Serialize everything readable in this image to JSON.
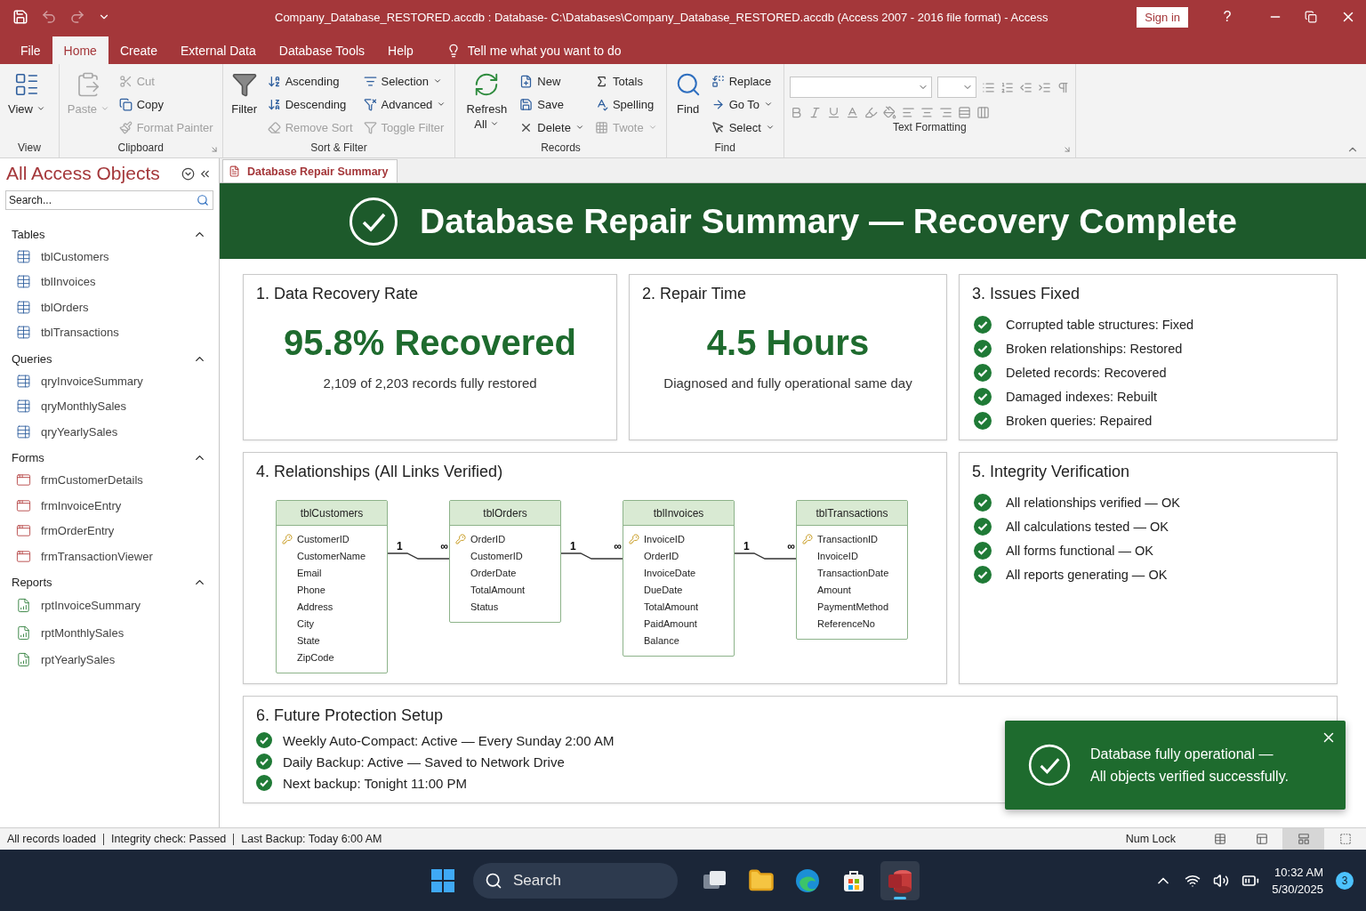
{
  "window": {
    "title": "Company_Database_RESTORED.accdb : Database- C:\\Databases\\Company_Database_RESTORED.accdb (Access 2007 - 2016 file format) - Access",
    "sign_in": "Sign in",
    "help": "?"
  },
  "menu_tabs": [
    {
      "label": "File",
      "selected": false
    },
    {
      "label": "Home",
      "selected": true
    },
    {
      "label": "Create",
      "selected": false
    },
    {
      "label": "External Data",
      "selected": false
    },
    {
      "label": "Database Tools",
      "selected": false
    },
    {
      "label": "Help",
      "selected": false
    }
  ],
  "tell_me": "Tell me what you want to do",
  "ribbon": {
    "groups": [
      {
        "label": "View",
        "kind": "buttons",
        "launcher": false,
        "large": {
          "kind": "view",
          "label": "View",
          "dropdown": true,
          "disabled": false
        }
      },
      {
        "label": "Clipboard",
        "kind": "buttons",
        "launcher": true,
        "large": {
          "kind": "paste",
          "label": "Paste",
          "dropdown": true,
          "disabled": true
        },
        "columns": [
          [
            {
              "kind": "cut",
              "label": "Cut",
              "dropdown": false,
              "disabled": true
            },
            {
              "kind": "copy",
              "label": "Copy",
              "dropdown": false,
              "disabled": false
            },
            {
              "kind": "painter",
              "label": "Format Painter",
              "dropdown": false,
              "disabled": true
            }
          ]
        ]
      },
      {
        "label": "Sort & Filter",
        "kind": "buttons",
        "launcher": false,
        "large": {
          "kind": "filter",
          "label": "Filter",
          "dropdown": false,
          "disabled": false
        },
        "columns": [
          [
            {
              "kind": "ascending",
              "label": "Ascending",
              "dropdown": false,
              "disabled": false
            },
            {
              "kind": "descending",
              "label": "Descending",
              "dropdown": false,
              "disabled": false
            },
            {
              "kind": "removesort",
              "label": "Remove Sort",
              "dropdown": false,
              "disabled": true
            }
          ],
          [
            {
              "kind": "selection",
              "label": "Selection",
              "dropdown": true,
              "disabled": false
            },
            {
              "kind": "advanced",
              "label": "Advanced",
              "dropdown": true,
              "disabled": false
            },
            {
              "kind": "toggle",
              "label": "Toggle Filter",
              "dropdown": false,
              "disabled": true
            }
          ]
        ]
      },
      {
        "label": "Records",
        "kind": "buttons",
        "launcher": false,
        "large": {
          "kind": "refresh",
          "label": "Refresh All",
          "dropdown": true,
          "disabled": false
        },
        "columns": [
          [
            {
              "kind": "new",
              "label": "New",
              "dropdown": false,
              "disabled": false
            },
            {
              "kind": "save",
              "label": "Save",
              "dropdown": false,
              "disabled": false
            },
            {
              "kind": "delete",
              "label": "Delete",
              "dropdown": true,
              "disabled": false
            }
          ],
          [
            {
              "kind": "totals",
              "label": "Totals",
              "dropdown": false,
              "disabled": false
            },
            {
              "kind": "spelling",
              "label": "Spelling",
              "dropdown": false,
              "disabled": false
            },
            {
              "kind": "more",
              "label": "Twote",
              "dropdown": true,
              "disabled": true
            }
          ]
        ]
      },
      {
        "label": "Find",
        "kind": "buttons",
        "launcher": false,
        "large": {
          "kind": "find",
          "label": "Find",
          "dropdown": false,
          "disabled": false
        },
        "columns": [
          [
            {
              "kind": "replace",
              "label": "Replace",
              "dropdown": false,
              "disabled": false
            },
            {
              "kind": "goto",
              "label": "Go To",
              "dropdown": true,
              "disabled": false
            },
            {
              "kind": "select",
              "label": "Select",
              "dropdown": true,
              "disabled": false
            }
          ]
        ]
      },
      {
        "label": "Text Formatting",
        "kind": "formatting",
        "launcher": true
      }
    ]
  },
  "nav": {
    "title": "All Access Objects",
    "search_placeholder": "Search...",
    "sections": [
      {
        "label": "Tables",
        "kind": "table",
        "expanded": true,
        "items": [
          "tblCustomers",
          "tblInvoices",
          "tblOrders",
          "tblTransactions"
        ]
      },
      {
        "label": "Queries",
        "kind": "query",
        "expanded": true,
        "items": [
          "qryInvoiceSummary",
          "qryMonthlySales",
          "qryYearlySales"
        ]
      },
      {
        "label": "Forms",
        "kind": "form",
        "expanded": true,
        "items": [
          "frmCustomerDetails",
          "frmInvoiceEntry",
          "frmOrderEntry",
          "frmTransactionViewer"
        ]
      },
      {
        "label": "Reports",
        "kind": "report",
        "expanded": true,
        "items": [
          "rptInvoiceSummary",
          "rptMonthlySales",
          "rptYearlySales"
        ]
      }
    ]
  },
  "document_tabs": [
    {
      "label": "Database Repair Summary",
      "selected": true
    }
  ],
  "banner": {
    "title": "Database Repair Summary — Recovery Complete"
  },
  "cards": [
    {
      "kind": "metric",
      "title": "1. Data Recovery Rate",
      "value": "95.8% Recovered",
      "caption": "2,109 of 2,203 records fully restored"
    },
    {
      "kind": "metric",
      "title": "2. Repair Time",
      "value": "4.5 Hours",
      "caption": "Diagnosed and fully operational same day"
    },
    {
      "kind": "checklist",
      "title": "3. Issues Fixed",
      "items": [
        "Corrupted table structures: Fixed",
        "Broken relationships: Restored",
        "Deleted records: Recovered",
        "Damaged indexes: Rebuilt",
        "Broken queries: Repaired"
      ]
    },
    {
      "kind": "diagram",
      "title": "4. Relationships (All Links Verified)",
      "tables": [
        {
          "name": "tblCustomers",
          "fields": [
            {
              "name": "CustomerID",
              "key": true
            },
            {
              "name": "CustomerName",
              "key": false
            },
            {
              "name": "Email",
              "key": false
            },
            {
              "name": "Phone",
              "key": false
            },
            {
              "name": "Address",
              "key": false
            },
            {
              "name": "City",
              "key": false
            },
            {
              "name": "State",
              "key": false
            },
            {
              "name": "ZipCode",
              "key": false
            }
          ]
        },
        {
          "name": "tblOrders",
          "fields": [
            {
              "name": "OrderID",
              "key": true
            },
            {
              "name": "CustomerID",
              "key": false
            },
            {
              "name": "OrderDate",
              "key": false
            },
            {
              "name": "TotalAmount",
              "key": false
            },
            {
              "name": "Status",
              "key": false
            }
          ]
        },
        {
          "name": "tblInvoices",
          "fields": [
            {
              "name": "InvoiceID",
              "key": true
            },
            {
              "name": "OrderID",
              "key": false
            },
            {
              "name": "InvoiceDate",
              "key": false
            },
            {
              "name": "DueDate",
              "key": false
            },
            {
              "name": "TotalAmount",
              "key": false
            },
            {
              "name": "PaidAmount",
              "key": false
            },
            {
              "name": "Balance",
              "key": false
            }
          ]
        },
        {
          "name": "tblTransactions",
          "fields": [
            {
              "name": "TransactionID",
              "key": true
            },
            {
              "name": "InvoiceID",
              "key": false
            },
            {
              "name": "TransactionDate",
              "key": false
            },
            {
              "name": "Amount",
              "key": false
            },
            {
              "name": "PaymentMethod",
              "key": false
            },
            {
              "name": "ReferenceNo",
              "key": false
            }
          ]
        }
      ],
      "relationships": [
        {
          "one": "1",
          "many": "∞"
        },
        {
          "one": "1",
          "many": "∞"
        },
        {
          "one": "1",
          "many": "∞"
        }
      ]
    },
    {
      "kind": "checklist",
      "title": "5. Integrity Verification",
      "items": [
        "All relationships verified — OK",
        "All calculations tested — OK",
        "All forms functional — OK",
        "All reports generating — OK"
      ]
    },
    {
      "kind": "setup",
      "title": "6. Future Protection Setup",
      "items": [
        "Weekly Auto-Compact: Active — Every Sunday 2:00 AM",
        "Daily Backup: Active — Saved to Network Drive",
        "Next backup: Tonight 11:00 PM"
      ]
    }
  ],
  "toast": {
    "lines": [
      "Database fully operational —",
      "All objects verified successfully."
    ]
  },
  "status_bar": {
    "items": [
      "All records loaded",
      "Integrity check: Passed",
      "Last Backup: Today 6:00 AM"
    ],
    "num_lock": "Num Lock",
    "views": [
      {
        "selected": false
      },
      {
        "selected": false
      },
      {
        "selected": true
      },
      {
        "selected": false
      }
    ]
  },
  "taskbar": {
    "search_placeholder": "Search",
    "apps": [
      {
        "kind": "taskview",
        "active": false
      },
      {
        "kind": "explorer",
        "active": false
      },
      {
        "kind": "edge",
        "active": false
      },
      {
        "kind": "store",
        "active": false
      },
      {
        "kind": "access",
        "active": true
      }
    ],
    "time": "10:32 AM",
    "date": "5/30/2025",
    "notifications": "3"
  }
}
